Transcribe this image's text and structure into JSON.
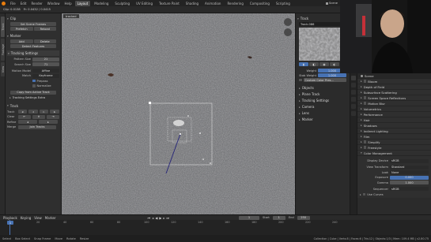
{
  "menu": [
    "File",
    "Edit",
    "Render",
    "Window",
    "Help"
  ],
  "workspaces": [
    "Layout",
    "Modeling",
    "Sculpting",
    "UV Editing",
    "Texture Paint",
    "Shading",
    "Animation",
    "Rendering",
    "Compositing",
    "Scripting"
  ],
  "scene_label": "Scene",
  "header_info": {
    "clip_info": "Clip: 0.0138",
    "frame": "Fr: 0.0432 / 0.0415",
    "tracked_label": "tracked"
  },
  "vtabs": [
    "Track",
    "Footage",
    "View"
  ],
  "clip_panel": {
    "title": "Clip",
    "set_scene_frames": "Set Scene Frames",
    "prefetch": "Prefetch",
    "reload": "Reload"
  },
  "marker_panel": {
    "title": "Marker",
    "add": "Add",
    "delete": "Delete",
    "detect_features": "Detect Features"
  },
  "tracking_settings": {
    "title": "Tracking Settings",
    "pattern_size_label": "Pattern Size",
    "pattern_size": "21",
    "search_size_label": "Search Size",
    "search_size": "71",
    "motion_model_label": "Motion Model",
    "motion_model": "Affine",
    "match_label": "Match",
    "match": "Keyframe",
    "prepass_label": "Prepass",
    "normalize_label": "Normalize",
    "copy_button": "Copy from Active Track",
    "extra_label": "Tracking Settings Extra"
  },
  "track_panel": {
    "title": "Track",
    "track_label": "Track",
    "clear_label": "Clear",
    "refine_label": "Refine",
    "merge_label": "Merge",
    "join_tracks": "Join Tracks"
  },
  "right_track_panel": {
    "title": "Track",
    "track_name": "Track.086",
    "weight_label": "Weight",
    "weight_value": "1.000",
    "stab_weight_label": "Stab Weight",
    "stab_weight_value": "1.000",
    "custom_color_label": "Custom Color Pres..."
  },
  "right_sections": [
    "Objects",
    "Plane Track",
    "Tracking Settings",
    "Camera",
    "Lens",
    "Marker"
  ],
  "properties": {
    "scene_label": "Scene",
    "rows": [
      "Bloom",
      "Depth of Field",
      "Subsurface Scattering",
      "Screen Space Reflections",
      "Motion Blur",
      "Volumetrics",
      "Performance",
      "Hair",
      "Shadows",
      "Indirect Lighting",
      "Film",
      "Simplify",
      "Freestyle",
      "Color Management"
    ],
    "display_device_label": "Display Device",
    "display_device": "sRGB",
    "view_transform_label": "View Transform",
    "view_transform": "Standard",
    "look_label": "Look",
    "look": "None",
    "exposure_label": "Exposure",
    "exposure": "0.000",
    "gamma_label": "Gamma",
    "gamma": "1.000",
    "sequencer_label": "Sequencer",
    "sequencer": "sRGB",
    "use_curves": "Use Curves"
  },
  "timeline": {
    "playback": "Playback",
    "keying": "Keying",
    "view": "View",
    "marker": "Marker",
    "current_frame": "1",
    "start_label": "Start",
    "start": "1",
    "end_label": "End",
    "end": "250",
    "ticks": [
      "1",
      "20",
      "40",
      "60",
      "80",
      "100",
      "120",
      "140",
      "160",
      "180",
      "200",
      "220",
      "240"
    ]
  },
  "status_bar": {
    "items": [
      "Select",
      "Box Select",
      "Snap Frame",
      "Move",
      "Rotate",
      "Resize"
    ],
    "right": "Collection | Cube | Verts:8 | Faces:6 | Tris:12 | Objects:1/3 | Mem: 109.4 MB | v2.80.75"
  },
  "colors": {
    "accent": "#4772b3",
    "active_tab": "#4a4a4a",
    "track_line": "#2b2a7a",
    "timeline_cursor": "#4772b3"
  }
}
